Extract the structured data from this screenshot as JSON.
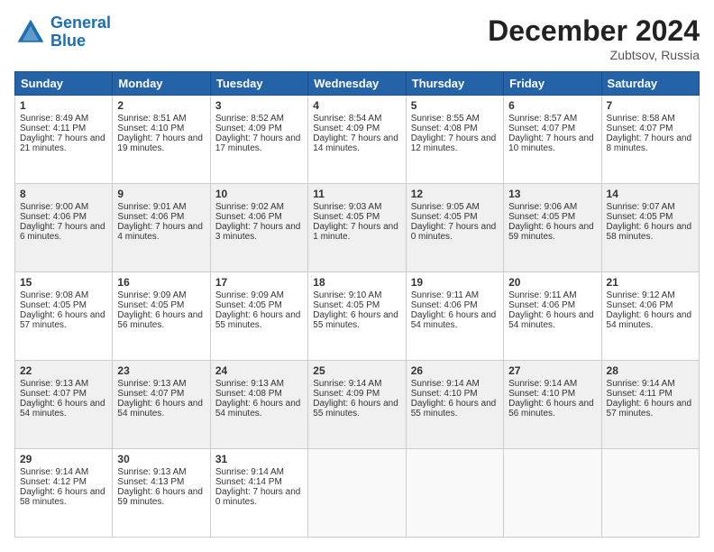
{
  "logo": {
    "line1": "General",
    "line2": "Blue"
  },
  "header": {
    "month": "December 2024",
    "location": "Zubtsov, Russia"
  },
  "days_of_week": [
    "Sunday",
    "Monday",
    "Tuesday",
    "Wednesday",
    "Thursday",
    "Friday",
    "Saturday"
  ],
  "weeks": [
    [
      {
        "day": "1",
        "sunrise": "8:49 AM",
        "sunset": "4:11 PM",
        "daylight": "7 hours and 21 minutes."
      },
      {
        "day": "2",
        "sunrise": "8:51 AM",
        "sunset": "4:10 PM",
        "daylight": "7 hours and 19 minutes."
      },
      {
        "day": "3",
        "sunrise": "8:52 AM",
        "sunset": "4:09 PM",
        "daylight": "7 hours and 17 minutes."
      },
      {
        "day": "4",
        "sunrise": "8:54 AM",
        "sunset": "4:09 PM",
        "daylight": "7 hours and 14 minutes."
      },
      {
        "day": "5",
        "sunrise": "8:55 AM",
        "sunset": "4:08 PM",
        "daylight": "7 hours and 12 minutes."
      },
      {
        "day": "6",
        "sunrise": "8:57 AM",
        "sunset": "4:07 PM",
        "daylight": "7 hours and 10 minutes."
      },
      {
        "day": "7",
        "sunrise": "8:58 AM",
        "sunset": "4:07 PM",
        "daylight": "7 hours and 8 minutes."
      }
    ],
    [
      {
        "day": "8",
        "sunrise": "9:00 AM",
        "sunset": "4:06 PM",
        "daylight": "7 hours and 6 minutes."
      },
      {
        "day": "9",
        "sunrise": "9:01 AM",
        "sunset": "4:06 PM",
        "daylight": "7 hours and 4 minutes."
      },
      {
        "day": "10",
        "sunrise": "9:02 AM",
        "sunset": "4:06 PM",
        "daylight": "7 hours and 3 minutes."
      },
      {
        "day": "11",
        "sunrise": "9:03 AM",
        "sunset": "4:05 PM",
        "daylight": "7 hours and 1 minute."
      },
      {
        "day": "12",
        "sunrise": "9:05 AM",
        "sunset": "4:05 PM",
        "daylight": "7 hours and 0 minutes."
      },
      {
        "day": "13",
        "sunrise": "9:06 AM",
        "sunset": "4:05 PM",
        "daylight": "6 hours and 59 minutes."
      },
      {
        "day": "14",
        "sunrise": "9:07 AM",
        "sunset": "4:05 PM",
        "daylight": "6 hours and 58 minutes."
      }
    ],
    [
      {
        "day": "15",
        "sunrise": "9:08 AM",
        "sunset": "4:05 PM",
        "daylight": "6 hours and 57 minutes."
      },
      {
        "day": "16",
        "sunrise": "9:09 AM",
        "sunset": "4:05 PM",
        "daylight": "6 hours and 56 minutes."
      },
      {
        "day": "17",
        "sunrise": "9:09 AM",
        "sunset": "4:05 PM",
        "daylight": "6 hours and 55 minutes."
      },
      {
        "day": "18",
        "sunrise": "9:10 AM",
        "sunset": "4:05 PM",
        "daylight": "6 hours and 55 minutes."
      },
      {
        "day": "19",
        "sunrise": "9:11 AM",
        "sunset": "4:06 PM",
        "daylight": "6 hours and 54 minutes."
      },
      {
        "day": "20",
        "sunrise": "9:11 AM",
        "sunset": "4:06 PM",
        "daylight": "6 hours and 54 minutes."
      },
      {
        "day": "21",
        "sunrise": "9:12 AM",
        "sunset": "4:06 PM",
        "daylight": "6 hours and 54 minutes."
      }
    ],
    [
      {
        "day": "22",
        "sunrise": "9:13 AM",
        "sunset": "4:07 PM",
        "daylight": "6 hours and 54 minutes."
      },
      {
        "day": "23",
        "sunrise": "9:13 AM",
        "sunset": "4:07 PM",
        "daylight": "6 hours and 54 minutes."
      },
      {
        "day": "24",
        "sunrise": "9:13 AM",
        "sunset": "4:08 PM",
        "daylight": "6 hours and 54 minutes."
      },
      {
        "day": "25",
        "sunrise": "9:14 AM",
        "sunset": "4:09 PM",
        "daylight": "6 hours and 55 minutes."
      },
      {
        "day": "26",
        "sunrise": "9:14 AM",
        "sunset": "4:10 PM",
        "daylight": "6 hours and 55 minutes."
      },
      {
        "day": "27",
        "sunrise": "9:14 AM",
        "sunset": "4:10 PM",
        "daylight": "6 hours and 56 minutes."
      },
      {
        "day": "28",
        "sunrise": "9:14 AM",
        "sunset": "4:11 PM",
        "daylight": "6 hours and 57 minutes."
      }
    ],
    [
      {
        "day": "29",
        "sunrise": "9:14 AM",
        "sunset": "4:12 PM",
        "daylight": "6 hours and 58 minutes."
      },
      {
        "day": "30",
        "sunrise": "9:13 AM",
        "sunset": "4:13 PM",
        "daylight": "6 hours and 59 minutes."
      },
      {
        "day": "31",
        "sunrise": "9:14 AM",
        "sunset": "4:14 PM",
        "daylight": "7 hours and 0 minutes."
      },
      null,
      null,
      null,
      null
    ]
  ]
}
